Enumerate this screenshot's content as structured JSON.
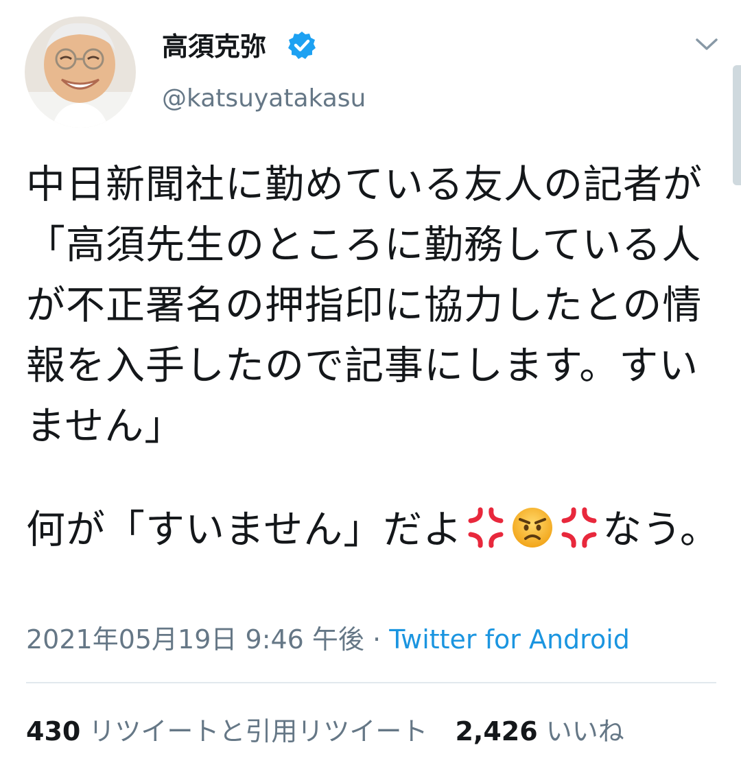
{
  "header": {
    "display_name": "高須克弥",
    "handle": "@katsuyatakasu",
    "verified": true,
    "verified_icon": "verified-badge-icon",
    "menu_icon": "chevron-down-icon",
    "avatar_icon": "avatar"
  },
  "tweet": {
    "paragraph1": "中日新聞社に勤めている友人の記者が「高須先生のところに勤務している人が不正署名の押指印に協力したとの情報を入手したので記事にします。すいません」",
    "paragraph2_before": "何が「すいません」だよ",
    "paragraph2_after": "なう。",
    "emojis": [
      "anger-symbol-icon",
      "angry-face-icon",
      "anger-symbol-icon"
    ]
  },
  "meta": {
    "date": "2021年05月19日",
    "time": "9:46 午後",
    "separator": " · ",
    "source": "Twitter for Android"
  },
  "stats": {
    "retweets_count": "430",
    "retweets_label": "リツイートと引用リツイート",
    "likes_count": "2,426",
    "likes_label": "いいね"
  },
  "colors": {
    "link": "#1b95e0",
    "secondary_text": "#657786",
    "primary_text": "#14171a",
    "verified": "#1da1f2",
    "anger_symbol": "#e8283c",
    "angry_face": "#f7b733"
  }
}
